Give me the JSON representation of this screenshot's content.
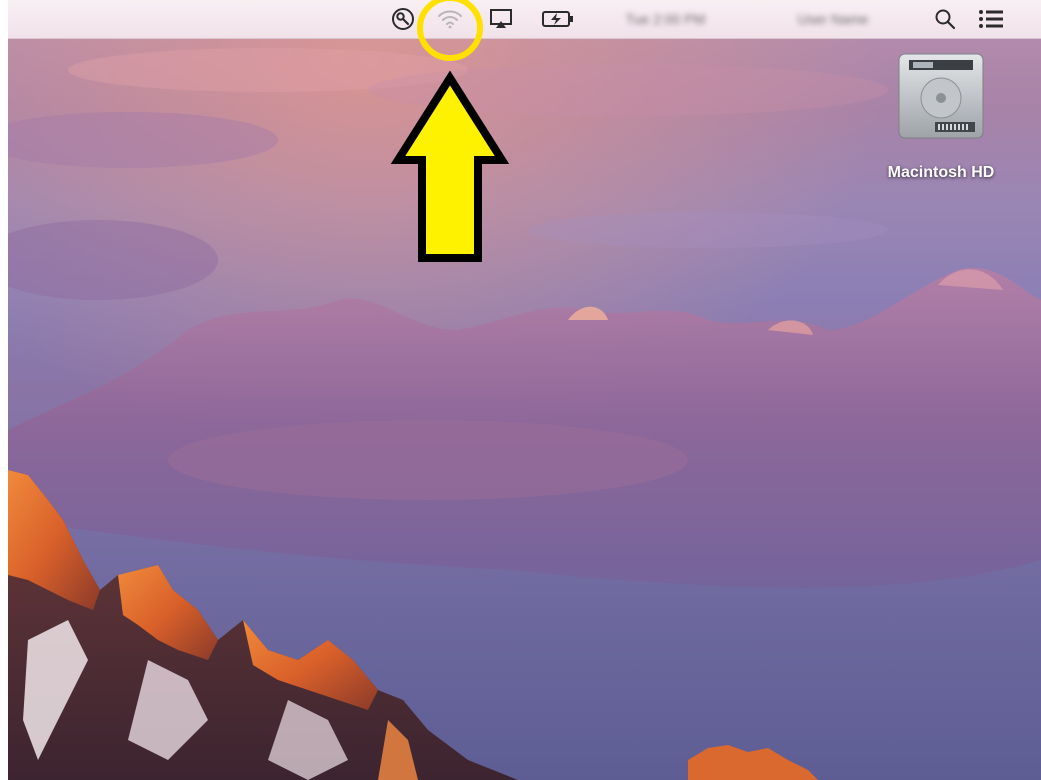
{
  "menubar": {
    "items": [
      {
        "name": "spotlight-key-icon",
        "label": ""
      },
      {
        "name": "wifi-icon",
        "label": ""
      },
      {
        "name": "airplay-icon",
        "label": ""
      },
      {
        "name": "battery-charging-icon",
        "label": ""
      },
      {
        "name": "search-icon",
        "label": ""
      },
      {
        "name": "notification-center-icon",
        "label": ""
      }
    ],
    "blurred_user_text": "User Name",
    "blurred_clock_text": "Tue 2:00 PM"
  },
  "desktop": {
    "icons": [
      {
        "name": "macintosh-hd-icon",
        "label": "Macintosh HD"
      }
    ]
  },
  "annotation": {
    "highlight_color": "#ffe000",
    "arrow_fill": "#fff200",
    "arrow_stroke": "#000000",
    "target": "wifi-icon"
  },
  "colors": {
    "menubar_bg": "#f4e8ee",
    "icon_gray": "#2b2b2b",
    "wifi_disabled": "#b9b4b8"
  }
}
